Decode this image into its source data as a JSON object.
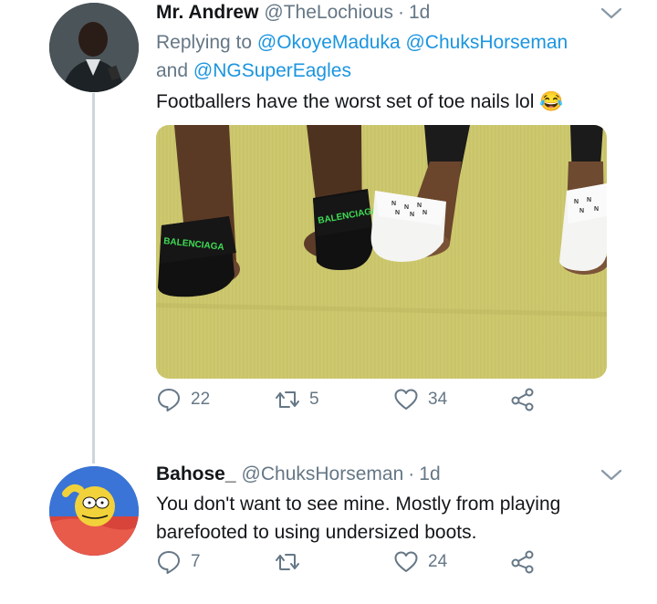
{
  "tweets": [
    {
      "name": "Mr. Andrew",
      "handle": "@TheLochious",
      "separator": "·",
      "time": "1d",
      "reply_prefix": "Replying to",
      "reply_mentions": [
        "@OkoyeMaduka",
        "@ChuksHorseman",
        "@NGSuperEagles"
      ],
      "reply_and": "and",
      "text": "Footballers have the worst set of toe nails lol 😂",
      "has_media": true,
      "media_text": [
        "BALENCIAGA",
        "BALENCIAGA"
      ],
      "reply_count": "22",
      "retweet_count": "5",
      "like_count": "34"
    },
    {
      "name": "Bahose_",
      "handle": "@ChuksHorseman",
      "separator": "·",
      "time": "1d",
      "text_line1": "You don't want to see mine. Mostly from playing",
      "text_line2": "barefooted to using undersized boots.",
      "reply_count": "7",
      "retweet_count": "",
      "like_count": "24"
    }
  ],
  "icons": {
    "reply": "reply-icon",
    "retweet": "retweet-icon",
    "like": "heart-icon",
    "share": "share-icon",
    "menu": "chevron-down-icon"
  },
  "colors": {
    "link": "#1b95e0",
    "muted": "#657786",
    "text": "#14171a",
    "thread_line": "#cdd6dd"
  }
}
